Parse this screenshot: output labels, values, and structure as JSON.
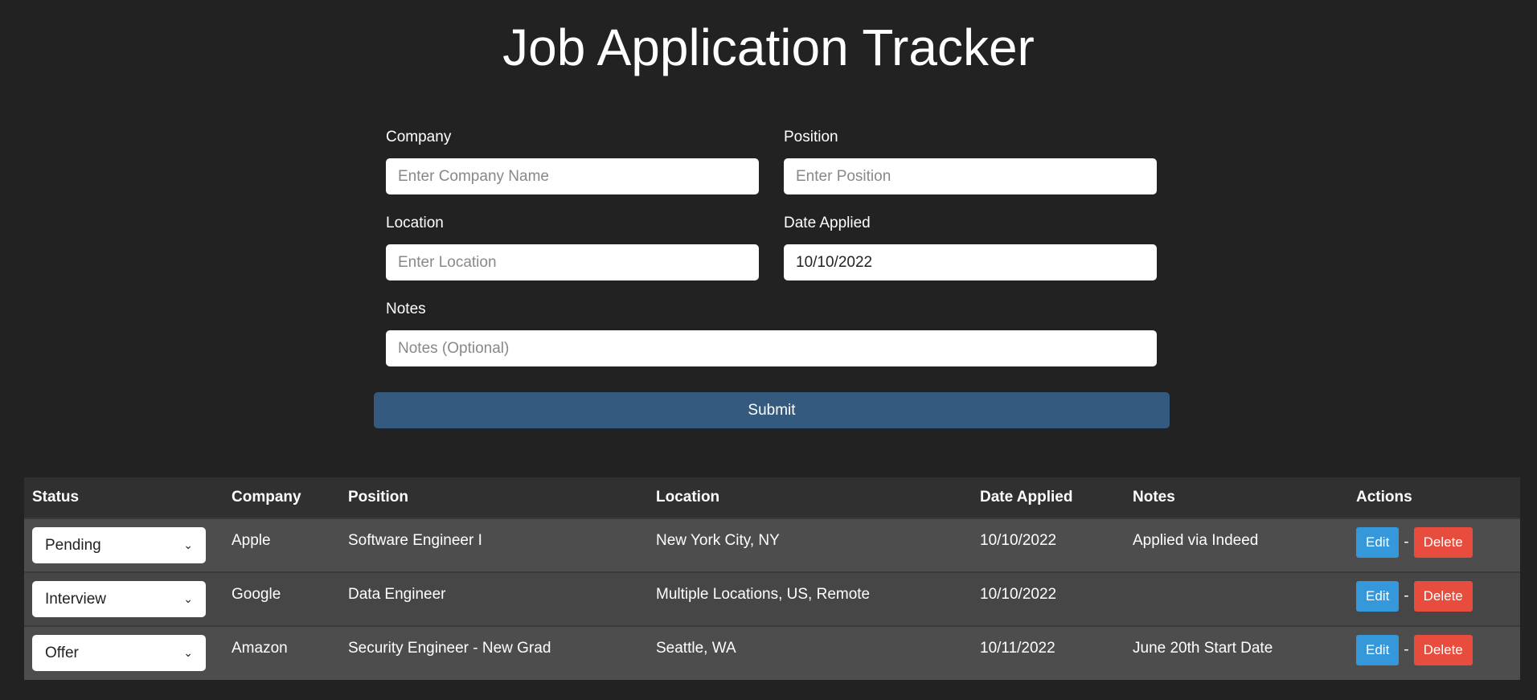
{
  "title": "Job Application Tracker",
  "form": {
    "company": {
      "label": "Company",
      "placeholder": "Enter Company Name",
      "value": ""
    },
    "position": {
      "label": "Position",
      "placeholder": "Enter Position",
      "value": ""
    },
    "location": {
      "label": "Location",
      "placeholder": "Enter Location",
      "value": ""
    },
    "date": {
      "label": "Date Applied",
      "value": "10/10/2022"
    },
    "notes": {
      "label": "Notes",
      "placeholder": "Notes (Optional)",
      "value": ""
    },
    "submit": "Submit"
  },
  "table": {
    "headers": [
      "Status",
      "Company",
      "Position",
      "Location",
      "Date Applied",
      "Notes",
      "Actions"
    ],
    "rows": [
      {
        "status": "Pending",
        "company": "Apple",
        "position": "Software Engineer I",
        "location": "New York City, NY",
        "date": "10/10/2022",
        "notes": "Applied via Indeed"
      },
      {
        "status": "Interview",
        "company": "Google",
        "position": "Data Engineer",
        "location": "Multiple Locations, US, Remote",
        "date": "10/10/2022",
        "notes": ""
      },
      {
        "status": "Offer",
        "company": "Amazon",
        "position": "Security Engineer - New Grad",
        "location": "Seattle, WA",
        "date": "10/11/2022",
        "notes": "June 20th Start Date"
      }
    ],
    "edit_label": "Edit",
    "delete_label": "Delete",
    "separator": "-"
  },
  "colors": {
    "background": "#222222",
    "submit": "#345a80",
    "edit": "#3498db",
    "delete": "#e74c3c"
  }
}
